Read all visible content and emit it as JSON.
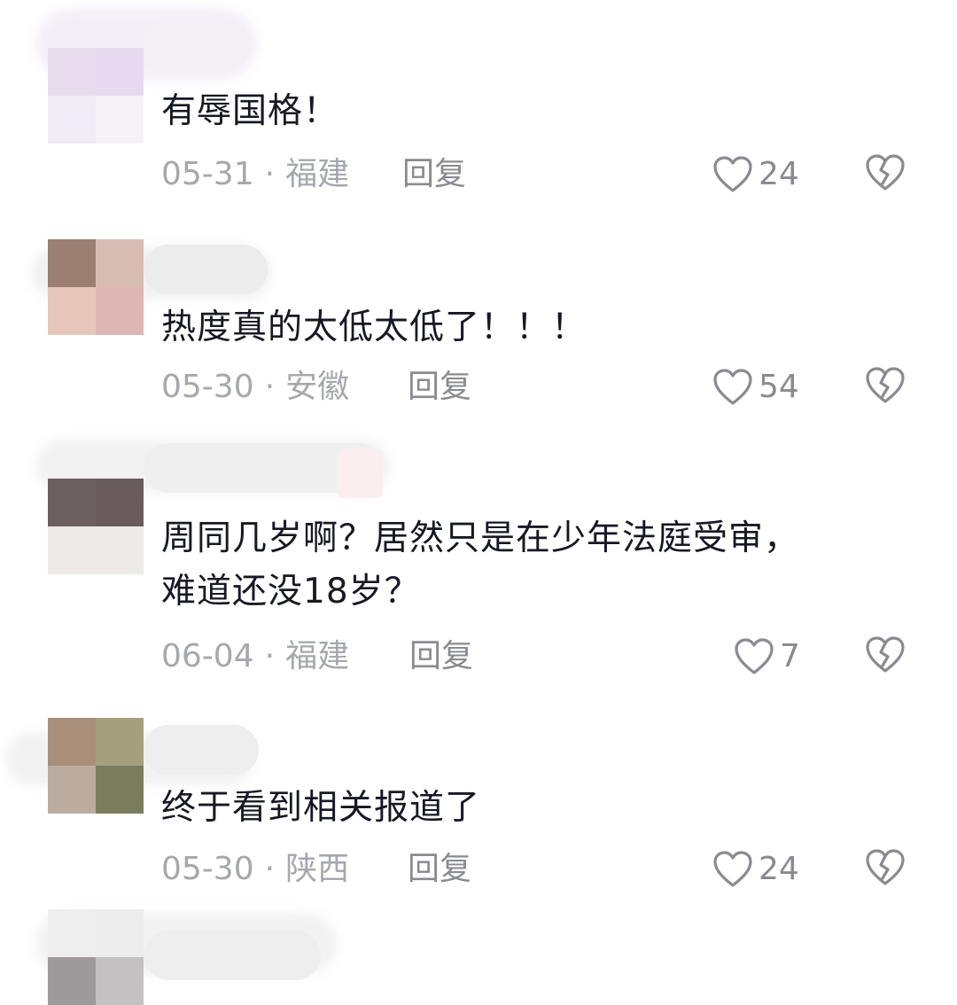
{
  "colors": {
    "text": "#161823",
    "meta": "#a6a8ad",
    "action": "#8a8b91",
    "icon_stroke": "#8a8b91"
  },
  "comments": [
    {
      "text_lines": [
        "有辱国格！"
      ],
      "date": "05-31",
      "separator": "·",
      "location": "福建",
      "reply_label": "回复",
      "like_count": "24",
      "like_icon": "heart-outline-icon",
      "dislike_icon": "broken-heart-icon"
    },
    {
      "text_lines": [
        "热度真的太低太低了！！！"
      ],
      "date": "05-30",
      "separator": "·",
      "location": "安徽",
      "reply_label": "回复",
      "like_count": "54",
      "like_icon": "heart-outline-icon",
      "dislike_icon": "broken-heart-icon"
    },
    {
      "text_lines": [
        "周同几岁啊？居然只是在少年法庭受审，",
        "难道还没18岁？"
      ],
      "date": "06-04",
      "separator": "·",
      "location": "福建",
      "reply_label": "回复",
      "like_count": "7",
      "like_icon": "heart-outline-icon",
      "dislike_icon": "broken-heart-icon"
    },
    {
      "text_lines": [
        "终于看到相关报道了"
      ],
      "date": "05-30",
      "separator": "·",
      "location": "陕西",
      "reply_label": "回复",
      "like_count": "24",
      "like_icon": "heart-outline-icon",
      "dislike_icon": "broken-heart-icon"
    }
  ]
}
